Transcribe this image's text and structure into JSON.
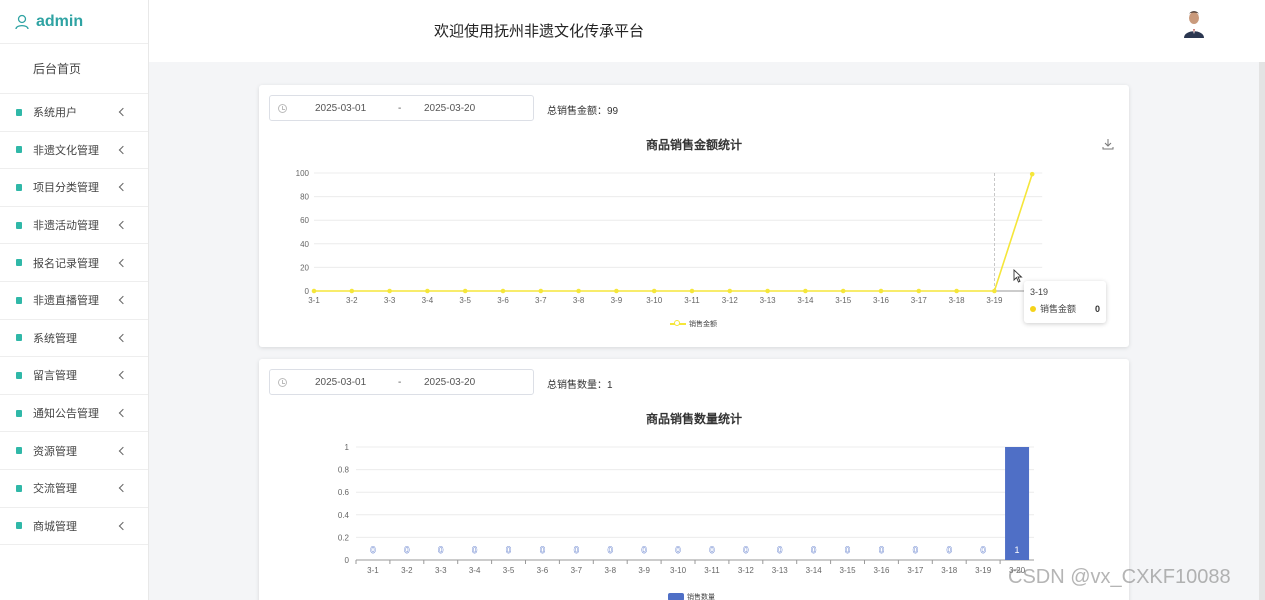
{
  "brand": {
    "title": "admin"
  },
  "header": {
    "title": "欢迎使用抚州非遗文化传承平台"
  },
  "sidebar": {
    "home": "后台首页",
    "items": [
      {
        "label": "系统用户"
      },
      {
        "label": "非遗文化管理"
      },
      {
        "label": "项目分类管理"
      },
      {
        "label": "非遗活动管理"
      },
      {
        "label": "报名记录管理"
      },
      {
        "label": "非遗直播管理"
      },
      {
        "label": "系统管理"
      },
      {
        "label": "留言管理"
      },
      {
        "label": "通知公告管理"
      },
      {
        "label": "资源管理"
      },
      {
        "label": "交流管理"
      },
      {
        "label": "商城管理"
      }
    ]
  },
  "card1": {
    "date_start": "2025-03-01",
    "date_sep": "-",
    "date_end": "2025-03-20",
    "total": "总销售金额：99"
  },
  "card2": {
    "date_start": "2025-03-01",
    "date_sep": "-",
    "date_end": "2025-03-20",
    "total": "总销售数量：1"
  },
  "tooltip": {
    "title": "3-19",
    "series": "销售金额",
    "value": "0"
  },
  "watermark": "CSDN @vx_CXKF10088",
  "colors": {
    "accent": "#2fa3a3",
    "line": "#f5e63a",
    "bar": "#4f6fc6",
    "menu_icon": "#30b8a8"
  },
  "chart_data": [
    {
      "type": "line",
      "title": "商品销售金额统计",
      "categories": [
        "3-1",
        "3-2",
        "3-3",
        "3-4",
        "3-5",
        "3-6",
        "3-7",
        "3-8",
        "3-9",
        "3-10",
        "3-11",
        "3-12",
        "3-13",
        "3-14",
        "3-15",
        "3-16",
        "3-17",
        "3-18",
        "3-19",
        "3-20"
      ],
      "series": [
        {
          "name": "销售金额",
          "values": [
            0,
            0,
            0,
            0,
            0,
            0,
            0,
            0,
            0,
            0,
            0,
            0,
            0,
            0,
            0,
            0,
            0,
            0,
            0,
            99
          ]
        }
      ],
      "yticks": [
        0,
        20,
        40,
        60,
        80,
        100
      ],
      "ylim": [
        0,
        100
      ],
      "legend": "bottom-center",
      "grid": true
    },
    {
      "type": "bar",
      "title": "商品销售数量统计",
      "categories": [
        "3-1",
        "3-2",
        "3-3",
        "3-4",
        "3-5",
        "3-6",
        "3-7",
        "3-8",
        "3-9",
        "3-10",
        "3-11",
        "3-12",
        "3-13",
        "3-14",
        "3-15",
        "3-16",
        "3-17",
        "3-18",
        "3-19",
        "3-20"
      ],
      "series": [
        {
          "name": "销售数量",
          "values": [
            0,
            0,
            0,
            0,
            0,
            0,
            0,
            0,
            0,
            0,
            0,
            0,
            0,
            0,
            0,
            0,
            0,
            0,
            0,
            1
          ]
        }
      ],
      "yticks": [
        0,
        0.2,
        0.4,
        0.6,
        0.8,
        1
      ],
      "ylim": [
        0,
        1
      ],
      "legend": "bottom-center",
      "grid": true
    }
  ]
}
